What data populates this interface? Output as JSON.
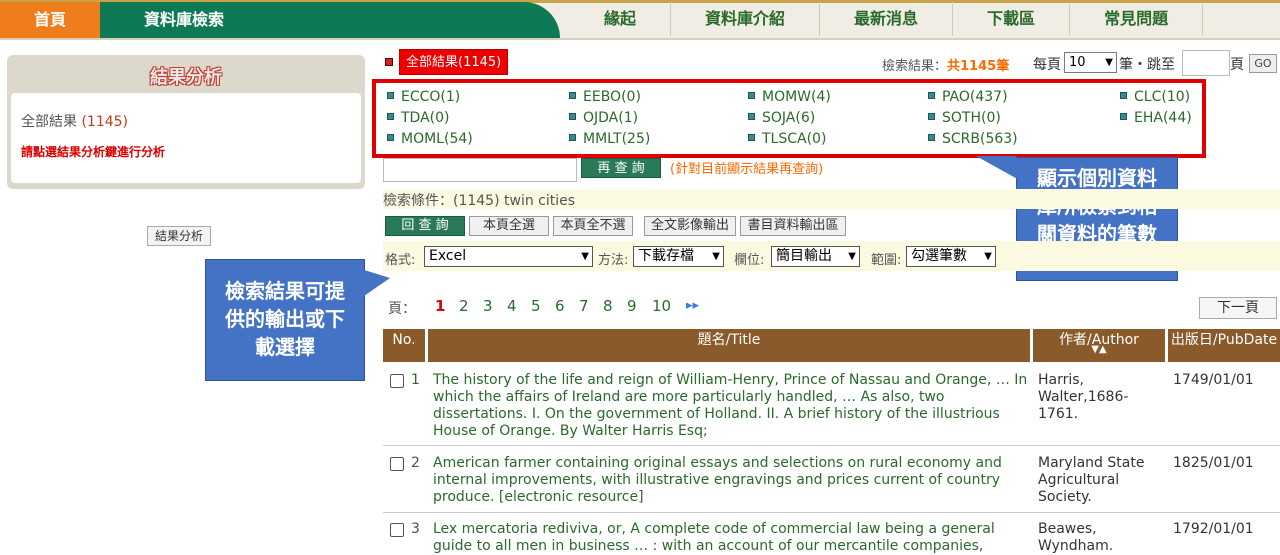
{
  "nav": {
    "home": "首頁",
    "db_search": "資料庫檢索",
    "items": [
      "緣起",
      "資料庫介紹",
      "最新消息",
      "下載區",
      "常見問題"
    ]
  },
  "sidebar": {
    "title": "結果分析",
    "all_label": "全部結果",
    "all_count": "(1145)",
    "hint": "請點選結果分析鍵進行分析",
    "button": "結果分析"
  },
  "results": {
    "all_results": "全部結果(1145)",
    "count_prefix": "檢索結果：",
    "count_value": "共1145筆",
    "per_page_label": "每頁",
    "per_page_value": "10",
    "jump_label": "筆・跳至",
    "page_label": "頁",
    "go": "GO"
  },
  "databases": [
    {
      "label": "ECCO(1)"
    },
    {
      "label": "EEBO(0)"
    },
    {
      "label": "MOMW(4)"
    },
    {
      "label": "PAO(437)"
    },
    {
      "label": "CLC(10)"
    },
    {
      "label": "TDA(0)"
    },
    {
      "label": "OJDA(1)"
    },
    {
      "label": "SOJA(6)"
    },
    {
      "label": "SOTH(0)"
    },
    {
      "label": "EHA(44)"
    },
    {
      "label": "MOML(54)"
    },
    {
      "label": "MMLT(25)"
    },
    {
      "label": "TLSCA(0)"
    },
    {
      "label": "SCRB(563)"
    }
  ],
  "requery": {
    "button": "再 查 詢",
    "hint": "(針對目前顯示結果再查詢)"
  },
  "condition": "檢索條件：(1145) twin cities",
  "toolbar": {
    "requery": "回 查 詢",
    "select_page": "本頁全選",
    "deselect_page": "本頁全不選",
    "fulltext_export": "全文影像輸出",
    "biblio_export": "書目資料輸出區"
  },
  "export": {
    "format_label": "格式:",
    "format_value": "Excel",
    "method_label": "方法:",
    "method_value": "下載存檔",
    "field_label": "欄位:",
    "field_value": "簡目輸出",
    "range_label": "範圍:",
    "range_value": "勾選筆數"
  },
  "pager": {
    "label": "頁：",
    "pages": [
      "1",
      "2",
      "3",
      "4",
      "5",
      "6",
      "7",
      "8",
      "9",
      "10"
    ],
    "more": "▸▸",
    "next": "下一頁"
  },
  "table": {
    "headers": {
      "no": "No.",
      "title": "題名/Title",
      "author": "作者/Author",
      "sort": "▼▲",
      "date": "出版日/PubDate"
    },
    "rows": [
      {
        "no": "1",
        "title": "The history of the life and reign of William-Henry, Prince of Nassau and Orange, … In which the affairs of Ireland are more particularly handled, … As also, two dissertations. I. On the government of Holland. II. A brief history of the illustrious House of Orange. By Walter Harris Esq;",
        "author": "Harris, Walter,1686-1761.",
        "date": "1749/01/01"
      },
      {
        "no": "2",
        "title": "American farmer containing original essays and selections on rural economy and internal improvements, with illustrative engravings and prices current of country produce. [electronic resource]",
        "author": "Maryland State Agricultural Society.",
        "date": "1825/01/01"
      },
      {
        "no": "3",
        "title": "Lex mercatoria rediviva, or, A complete code of commercial law being a general guide to all men in business … : with an account of our mercantile companies,",
        "author": "Beawes, Wyndham.",
        "date": "1792/01/01"
      }
    ]
  },
  "callouts": {
    "left": "檢索結果可提供的輸出或下載選擇",
    "right": "顯示個別資料庫所檢索到相關資料的筆數"
  },
  "colors": {
    "nav_orange": "#f07d1c",
    "nav_green": "#0e7a55",
    "highlight_red": "#e00000",
    "table_header": "#8b5a2b",
    "callout_blue": "#4472c4"
  }
}
